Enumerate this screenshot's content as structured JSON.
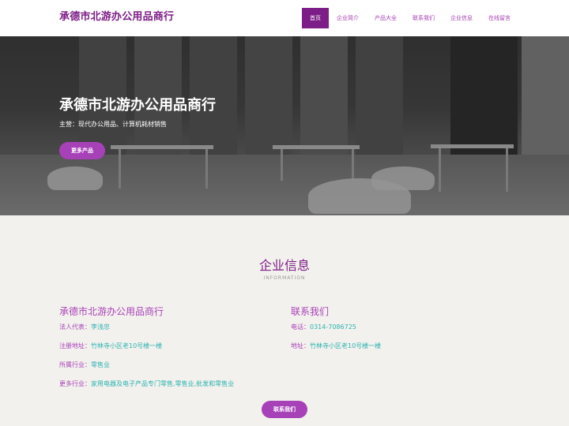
{
  "header": {
    "logo": "承德市北游办公用品商行",
    "nav": [
      "首页",
      "企业简介",
      "产品大全",
      "联系我们",
      "企业信息",
      "在线留言"
    ]
  },
  "hero": {
    "title": "承德市北游办公用品商行",
    "subtitle": "主营：现代办公用品、计算机耗材销售",
    "button": "更多产品"
  },
  "info": {
    "title": "企业信息",
    "subtitle": "INFORMATION",
    "company": {
      "title": "承德市北游办公用品商行",
      "rep_label": "法人代表：",
      "rep_value": "李浅忠",
      "addr_label": "注册地址：",
      "addr_value": "竹林寺小区老10号楼一楼",
      "industry_label": "所属行业：",
      "industry_value": "零售业",
      "more_label": "更多行业：",
      "more_value": "家用电器及电子产品专门零售,零售业,批发和零售业"
    },
    "contact": {
      "title": "联系我们",
      "phone_label": "电话：",
      "phone_value": "0314-7086725",
      "addr_label": "地址：",
      "addr_value": "竹林寺小区老10号楼一楼"
    },
    "button": "联系我们"
  },
  "colors": {
    "brand": "#7d1d87",
    "accent": "#a741b8",
    "text_teal": "#2bb3b1"
  }
}
